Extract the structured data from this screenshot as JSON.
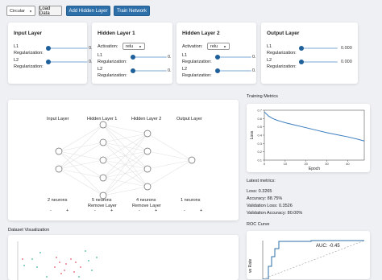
{
  "toolbar": {
    "dataset_select": "Circular",
    "load_data": "Load Data",
    "add_hidden_layer": "Add Hidden Layer",
    "train_network": "Train Network"
  },
  "layers": [
    {
      "title": "Input Layer",
      "l1_label": "L1",
      "reg_label": "Regularization:",
      "l2_label": "L2",
      "l1_value": "0.",
      "l2_value": "0."
    },
    {
      "title": "Hidden Layer 1",
      "activation_label": "Activation:",
      "activation": "relu",
      "l1_label": "L1",
      "reg_label": "Regularization:",
      "l2_label": "L2",
      "l1_value": "0.",
      "l2_value": "0."
    },
    {
      "title": "Hidden Layer 2",
      "activation_label": "Activation:",
      "activation": "relu",
      "l1_label": "L1",
      "reg_label": "Regularization:",
      "l2_label": "L2",
      "l1_value": "0.",
      "l2_value": "0."
    },
    {
      "title": "Output Layer",
      "l1_label": "L1",
      "reg_label": "Regularization:",
      "l2_label": "L2",
      "l1_value": "0.000",
      "l2_value": "0.000"
    }
  ],
  "network": {
    "columns": [
      {
        "label": "Input Layer",
        "neurons": 2,
        "count": "2 neurons",
        "minus": "-",
        "plus": "+"
      },
      {
        "label": "Hidden Layer 1",
        "neurons": 5,
        "count": "5 neurons",
        "remove": "Remove Layer",
        "minus": "-",
        "plus": "+"
      },
      {
        "label": "Hidden Layer 2",
        "neurons": 4,
        "count": "4 neurons",
        "remove": "Remove Layer",
        "minus": "-",
        "plus": "+"
      },
      {
        "label": "Output Layer",
        "neurons": 1,
        "count": "1 neurons",
        "minus": "-",
        "plus": "+"
      }
    ]
  },
  "training_metrics": {
    "title": "Training Metrics",
    "chart_data": {
      "type": "line",
      "xlabel": "Epoch",
      "ylabel": "Loss",
      "xlim": [
        0,
        48
      ],
      "ylim": [
        0.1,
        0.7
      ],
      "x_ticks": [
        "0",
        "10",
        "20",
        "30",
        "40"
      ],
      "y_ticks": [
        "0.1",
        "0.2",
        "0.3",
        "0.4",
        "0.5",
        "0.6",
        "0.7"
      ],
      "x": [
        0,
        2,
        4,
        6,
        8,
        10,
        15,
        20,
        25,
        30,
        35,
        40,
        45,
        48
      ],
      "values": [
        0.68,
        0.63,
        0.6,
        0.58,
        0.565,
        0.55,
        0.52,
        0.49,
        0.46,
        0.43,
        0.405,
        0.38,
        0.35,
        0.33
      ],
      "color": "#3a7dbf"
    }
  },
  "latest_metrics": {
    "title": "Latest metrics:",
    "lines": [
      "Loss: 0.3265",
      "Accuracy: 88.75%",
      "Validation Loss: 0.3526",
      "Validation Accuracy: 80.00%"
    ]
  },
  "dataset": {
    "title": "Dataset Visualization"
  },
  "roc": {
    "title": "ROC Curve",
    "auc": "AUC: -0.45",
    "ylabel": "ve Rate"
  }
}
